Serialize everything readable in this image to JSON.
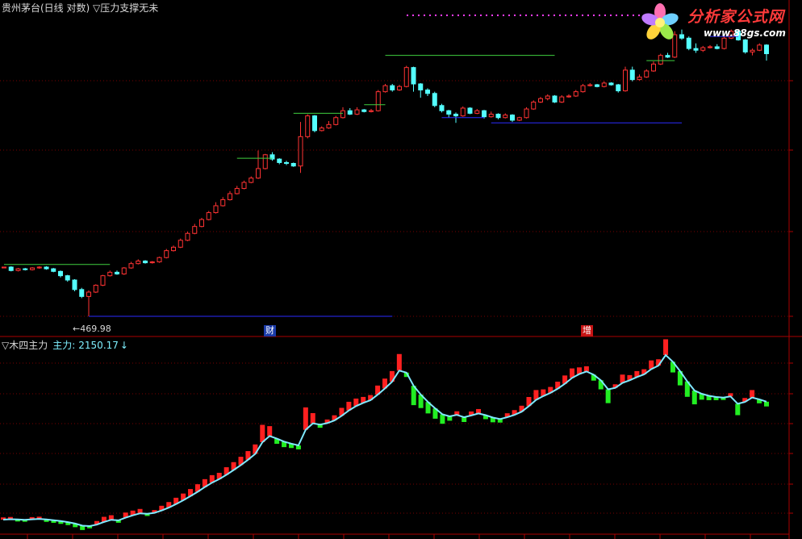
{
  "header": {
    "title": "贵州茅台(日线 对数) ▽压力支撑无未",
    "sub_name": "▽木四主力",
    "sub_label": "主力:",
    "sub_value": "2150.17",
    "sub_arrow": "↓"
  },
  "markers": {
    "low_price_label": "←469.98",
    "event_1": "财",
    "event_2": "增"
  },
  "logo": {
    "text": "分析家公式网",
    "url": "www.88gs.com"
  },
  "colors": {
    "background": "#000000",
    "up_candle": "#ff3333",
    "down_candle": "#54ffff",
    "main_line": "#7fe9ff",
    "bar_up": "#ff2020",
    "bar_down": "#22ee22",
    "resistance": "#3fcf3f",
    "support": "#2a2aff",
    "divider": "#aa0000",
    "grid": "#7a0000"
  },
  "chart_data": {
    "type": "candlestick",
    "candles": [
      {
        "o": 0.56,
        "c": 0.57,
        "h": 0.57,
        "l": 0.56
      },
      {
        "o": 0.57,
        "c": 0.53,
        "h": 0.58,
        "l": 0.52
      },
      {
        "o": 0.53,
        "c": 0.55,
        "h": 0.56,
        "l": 0.52
      },
      {
        "o": 0.55,
        "c": 0.54,
        "h": 0.56,
        "l": 0.53
      },
      {
        "o": 0.54,
        "c": 0.56,
        "h": 0.57,
        "l": 0.53
      },
      {
        "o": 0.56,
        "c": 0.57,
        "h": 0.58,
        "l": 0.55
      },
      {
        "o": 0.57,
        "c": 0.55,
        "h": 0.58,
        "l": 0.54
      },
      {
        "o": 0.55,
        "c": 0.52,
        "h": 0.56,
        "l": 0.51
      },
      {
        "o": 0.52,
        "c": 0.47,
        "h": 0.53,
        "l": 0.45
      },
      {
        "o": 0.47,
        "c": 0.42,
        "h": 0.48,
        "l": 0.4
      },
      {
        "o": 0.42,
        "c": 0.31,
        "h": 0.43,
        "l": 0.29
      },
      {
        "o": 0.31,
        "c": 0.23,
        "h": 0.33,
        "l": 0.21
      },
      {
        "o": 0.23,
        "c": 0.28,
        "h": 0.3,
        "l": 0.0
      },
      {
        "o": 0.28,
        "c": 0.36,
        "h": 0.37,
        "l": 0.27
      },
      {
        "o": 0.36,
        "c": 0.47,
        "h": 0.48,
        "l": 0.35
      },
      {
        "o": 0.47,
        "c": 0.51,
        "h": 0.53,
        "l": 0.46
      },
      {
        "o": 0.51,
        "c": 0.49,
        "h": 0.53,
        "l": 0.48
      },
      {
        "o": 0.49,
        "c": 0.56,
        "h": 0.57,
        "l": 0.48
      },
      {
        "o": 0.56,
        "c": 0.61,
        "h": 0.63,
        "l": 0.55
      },
      {
        "o": 0.61,
        "c": 0.64,
        "h": 0.66,
        "l": 0.6
      },
      {
        "o": 0.64,
        "c": 0.62,
        "h": 0.65,
        "l": 0.61
      },
      {
        "o": 0.62,
        "c": 0.63,
        "h": 0.64,
        "l": 0.61
      },
      {
        "o": 0.63,
        "c": 0.68,
        "h": 0.69,
        "l": 0.62
      },
      {
        "o": 0.68,
        "c": 0.76,
        "h": 0.78,
        "l": 0.67
      },
      {
        "o": 0.76,
        "c": 0.8,
        "h": 0.82,
        "l": 0.75
      },
      {
        "o": 0.8,
        "c": 0.88,
        "h": 0.9,
        "l": 0.79
      },
      {
        "o": 0.88,
        "c": 0.96,
        "h": 0.98,
        "l": 0.87
      },
      {
        "o": 0.96,
        "c": 1.04,
        "h": 1.07,
        "l": 0.95
      },
      {
        "o": 1.04,
        "c": 1.12,
        "h": 1.14,
        "l": 1.03
      },
      {
        "o": 1.12,
        "c": 1.2,
        "h": 1.22,
        "l": 1.11
      },
      {
        "o": 1.2,
        "c": 1.28,
        "h": 1.32,
        "l": 1.19
      },
      {
        "o": 1.28,
        "c": 1.35,
        "h": 1.38,
        "l": 1.27
      },
      {
        "o": 1.35,
        "c": 1.42,
        "h": 1.45,
        "l": 1.34
      },
      {
        "o": 1.42,
        "c": 1.48,
        "h": 1.51,
        "l": 1.41
      },
      {
        "o": 1.48,
        "c": 1.55,
        "h": 1.57,
        "l": 1.47
      },
      {
        "o": 1.55,
        "c": 1.6,
        "h": 1.62,
        "l": 1.54
      },
      {
        "o": 1.6,
        "c": 1.71,
        "h": 1.92,
        "l": 1.59
      },
      {
        "o": 1.71,
        "c": 1.87,
        "h": 1.88,
        "l": 1.7
      },
      {
        "o": 1.87,
        "c": 1.82,
        "h": 1.9,
        "l": 1.8
      },
      {
        "o": 1.82,
        "c": 1.78,
        "h": 1.83,
        "l": 1.76
      },
      {
        "o": 1.78,
        "c": 1.77,
        "h": 1.8,
        "l": 1.75
      },
      {
        "o": 1.77,
        "c": 1.74,
        "h": 1.78,
        "l": 1.73
      },
      {
        "o": 1.74,
        "c": 2.08,
        "h": 2.25,
        "l": 1.66
      },
      {
        "o": 2.08,
        "c": 2.32,
        "h": 2.34,
        "l": 2.06
      },
      {
        "o": 2.32,
        "c": 2.15,
        "h": 2.33,
        "l": 2.13
      },
      {
        "o": 2.15,
        "c": 2.18,
        "h": 2.2,
        "l": 2.14
      },
      {
        "o": 2.18,
        "c": 2.22,
        "h": 2.26,
        "l": 2.17
      },
      {
        "o": 2.22,
        "c": 2.3,
        "h": 2.32,
        "l": 2.21
      },
      {
        "o": 2.3,
        "c": 2.38,
        "h": 2.42,
        "l": 2.29
      },
      {
        "o": 2.38,
        "c": 2.34,
        "h": 2.41,
        "l": 2.33
      },
      {
        "o": 2.34,
        "c": 2.39,
        "h": 2.42,
        "l": 2.33
      },
      {
        "o": 2.39,
        "c": 2.37,
        "h": 2.4,
        "l": 2.36
      },
      {
        "o": 2.37,
        "c": 2.38,
        "h": 2.4,
        "l": 2.36
      },
      {
        "o": 2.38,
        "c": 2.6,
        "h": 2.62,
        "l": 2.37
      },
      {
        "o": 2.6,
        "c": 2.67,
        "h": 2.69,
        "l": 2.59
      },
      {
        "o": 2.67,
        "c": 2.62,
        "h": 2.69,
        "l": 2.6
      },
      {
        "o": 2.62,
        "c": 2.66,
        "h": 2.68,
        "l": 2.61
      },
      {
        "o": 2.66,
        "c": 2.88,
        "h": 2.9,
        "l": 2.65
      },
      {
        "o": 2.88,
        "c": 2.69,
        "h": 2.89,
        "l": 2.6
      },
      {
        "o": 2.69,
        "c": 2.62,
        "h": 2.7,
        "l": 2.53
      },
      {
        "o": 2.62,
        "c": 2.58,
        "h": 2.64,
        "l": 2.55
      },
      {
        "o": 2.58,
        "c": 2.44,
        "h": 2.6,
        "l": 2.42
      },
      {
        "o": 2.44,
        "c": 2.38,
        "h": 2.46,
        "l": 2.36
      },
      {
        "o": 2.38,
        "c": 2.34,
        "h": 2.39,
        "l": 2.3
      },
      {
        "o": 2.34,
        "c": 2.32,
        "h": 2.36,
        "l": 2.24
      },
      {
        "o": 2.32,
        "c": 2.41,
        "h": 2.43,
        "l": 2.31
      },
      {
        "o": 2.41,
        "c": 2.35,
        "h": 2.42,
        "l": 2.34
      },
      {
        "o": 2.35,
        "c": 2.38,
        "h": 2.4,
        "l": 2.34
      },
      {
        "o": 2.38,
        "c": 2.31,
        "h": 2.39,
        "l": 2.29
      },
      {
        "o": 2.31,
        "c": 2.34,
        "h": 2.37,
        "l": 2.3
      },
      {
        "o": 2.34,
        "c": 2.3,
        "h": 2.35,
        "l": 2.28
      },
      {
        "o": 2.3,
        "c": 2.33,
        "h": 2.35,
        "l": 2.29
      },
      {
        "o": 2.33,
        "c": 2.27,
        "h": 2.34,
        "l": 2.25
      },
      {
        "o": 2.27,
        "c": 2.3,
        "h": 2.31,
        "l": 2.26
      },
      {
        "o": 2.3,
        "c": 2.4,
        "h": 2.42,
        "l": 2.29
      },
      {
        "o": 2.4,
        "c": 2.48,
        "h": 2.5,
        "l": 2.39
      },
      {
        "o": 2.48,
        "c": 2.52,
        "h": 2.54,
        "l": 2.47
      },
      {
        "o": 2.52,
        "c": 2.55,
        "h": 2.57,
        "l": 2.5
      },
      {
        "o": 2.55,
        "c": 2.48,
        "h": 2.56,
        "l": 2.47
      },
      {
        "o": 2.48,
        "c": 2.54,
        "h": 2.56,
        "l": 2.47
      },
      {
        "o": 2.54,
        "c": 2.55,
        "h": 2.57,
        "l": 2.53
      },
      {
        "o": 2.55,
        "c": 2.6,
        "h": 2.62,
        "l": 2.54
      },
      {
        "o": 2.6,
        "c": 2.67,
        "h": 2.69,
        "l": 2.59
      },
      {
        "o": 2.67,
        "c": 2.68,
        "h": 2.7,
        "l": 2.66
      },
      {
        "o": 2.68,
        "c": 2.66,
        "h": 2.69,
        "l": 2.65
      },
      {
        "o": 2.66,
        "c": 2.7,
        "h": 2.72,
        "l": 2.65
      },
      {
        "o": 2.7,
        "c": 2.68,
        "h": 2.71,
        "l": 2.67
      },
      {
        "o": 2.68,
        "c": 2.61,
        "h": 2.69,
        "l": 2.59
      },
      {
        "o": 2.61,
        "c": 2.85,
        "h": 2.89,
        "l": 2.6
      },
      {
        "o": 2.85,
        "c": 2.74,
        "h": 2.89,
        "l": 2.72
      },
      {
        "o": 2.74,
        "c": 2.77,
        "h": 2.8,
        "l": 2.73
      },
      {
        "o": 2.77,
        "c": 2.84,
        "h": 2.86,
        "l": 2.76
      },
      {
        "o": 2.84,
        "c": 2.92,
        "h": 2.95,
        "l": 2.83
      },
      {
        "o": 2.92,
        "c": 3.02,
        "h": 3.04,
        "l": 2.91
      },
      {
        "o": 3.02,
        "c": 3.0,
        "h": 3.05,
        "l": 2.99
      },
      {
        "o": 3.0,
        "c": 3.26,
        "h": 3.3,
        "l": 2.99
      },
      {
        "o": 3.26,
        "c": 3.22,
        "h": 3.32,
        "l": 3.2
      },
      {
        "o": 3.22,
        "c": 3.1,
        "h": 3.24,
        "l": 3.08
      },
      {
        "o": 3.1,
        "c": 3.08,
        "h": 3.16,
        "l": 3.05
      },
      {
        "o": 3.08,
        "c": 3.11,
        "h": 3.13,
        "l": 3.06
      },
      {
        "o": 3.11,
        "c": 3.12,
        "h": 3.14,
        "l": 3.1
      },
      {
        "o": 3.12,
        "c": 3.1,
        "h": 3.15,
        "l": 3.09
      },
      {
        "o": 3.1,
        "c": 3.22,
        "h": 3.24,
        "l": 3.09
      },
      {
        "o": 3.22,
        "c": 3.3,
        "h": 3.32,
        "l": 3.21
      },
      {
        "o": 3.3,
        "c": 3.2,
        "h": 3.31,
        "l": 3.19
      },
      {
        "o": 3.2,
        "c": 3.06,
        "h": 3.21,
        "l": 3.04
      },
      {
        "o": 3.06,
        "c": 3.08,
        "h": 3.1,
        "l": 3.02
      },
      {
        "o": 3.08,
        "c": 3.14,
        "h": 3.16,
        "l": 3.07
      },
      {
        "o": 3.14,
        "c": 3.04,
        "h": 3.15,
        "l": 2.96
      }
    ],
    "indicator_bars": [
      0.3,
      0.3,
      -0.2,
      -0.2,
      0.3,
      0.3,
      -0.4,
      -0.5,
      -0.6,
      -0.7,
      -1.0,
      -1.4,
      -0.3,
      1.0,
      1.8,
      1.5,
      -0.4,
      1.8,
      1.6,
      1.4,
      -0.3,
      0.6,
      1.6,
      2.0,
      2.4,
      2.6,
      2.8,
      3.0,
      3.2,
      3.0,
      2.4,
      3.0,
      3.2,
      3.4,
      3.6,
      4.0,
      8.0,
      4.2,
      -1.8,
      -2.0,
      -1.4,
      -1.2,
      10.6,
      4.4,
      -0.8,
      1.0,
      1.8,
      3.2,
      3.6,
      3.0,
      2.2,
      1.8,
      3.8,
      4.2,
      4.6,
      7.6,
      -1.4,
      -9.0,
      -6.0,
      -5.0,
      -4.4,
      -4.0,
      -1.4,
      1.0,
      -1.6,
      1.2,
      1.4,
      -1.2,
      -1.6,
      -1.0,
      1.2,
      1.6,
      2.2,
      3.8,
      4.2,
      2.6,
      2.2,
      2.8,
      3.4,
      4.0,
      2.6,
      1.8,
      -2.2,
      -3.8,
      -6.2,
      1.0,
      3.4,
      1.8,
      2.2,
      1.8,
      3.6,
      2.4,
      7.2,
      -4.6,
      -6.4,
      -7.0,
      -6.2,
      -2.2,
      -1.4,
      -0.8,
      -0.4,
      0.8,
      -5.0,
      1.2,
      3.0,
      -1.2,
      -1.6
    ],
    "indicator_line_end": 2150.17,
    "price_axis": "log",
    "low_price": 469.98
  }
}
